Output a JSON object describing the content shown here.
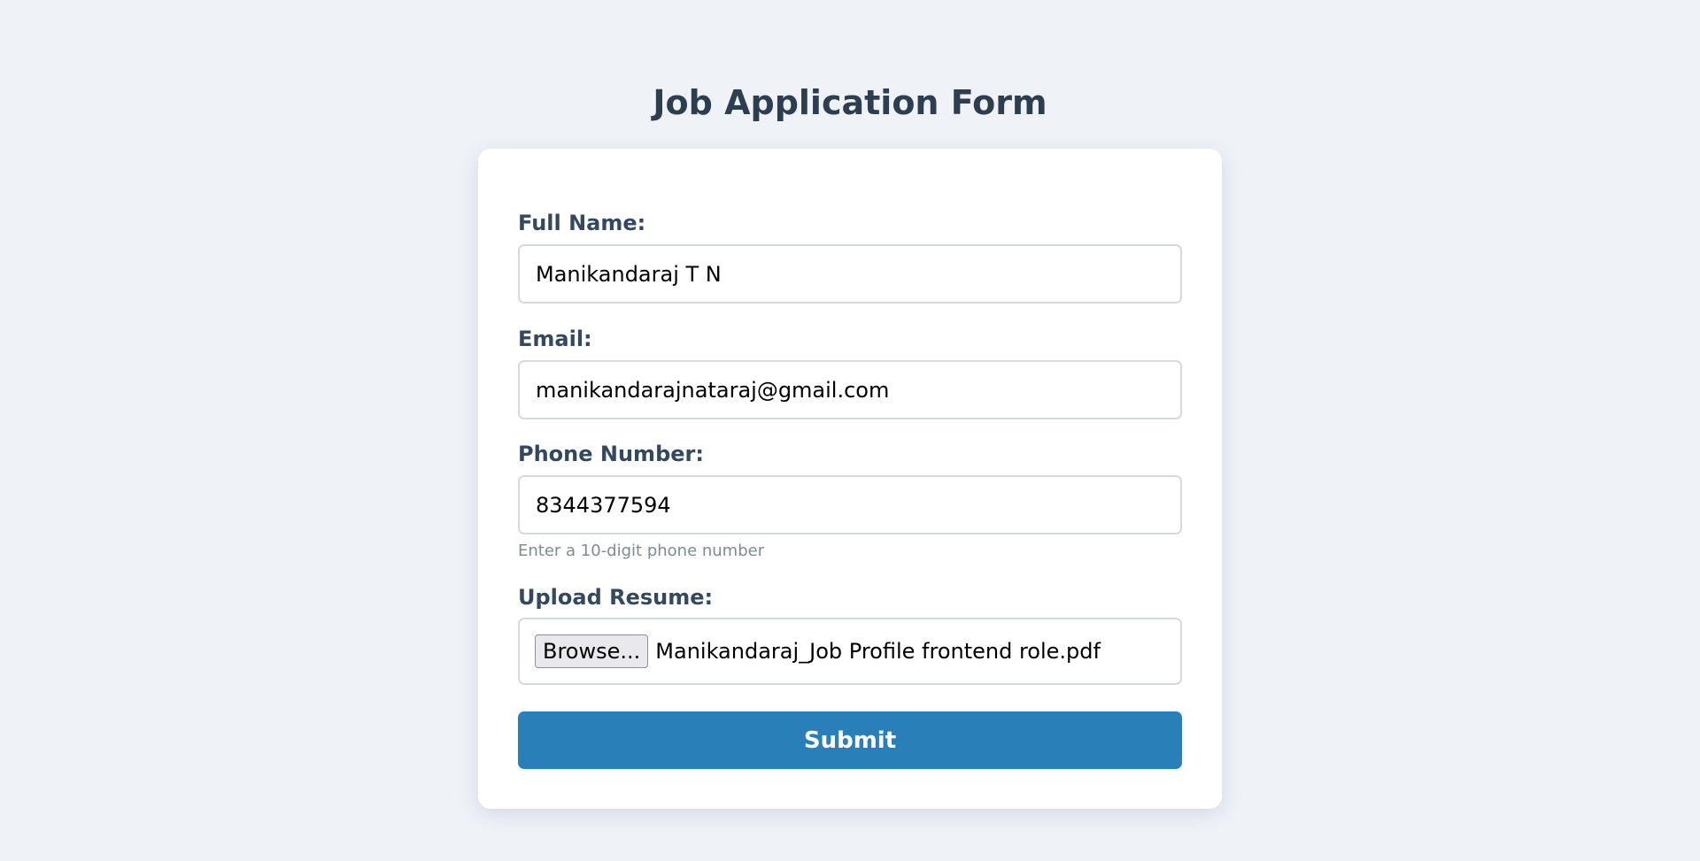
{
  "form": {
    "title": "Job Application Form",
    "full_name": {
      "label": "Full Name:",
      "value": "Manikandaraj T N"
    },
    "email": {
      "label": "Email:",
      "value": "manikandarajnataraj@gmail.com"
    },
    "phone": {
      "label": "Phone Number:",
      "value": "8344377594",
      "hint": "Enter a 10-digit phone number"
    },
    "resume": {
      "label": "Upload Resume:",
      "browse_label": "Browse...",
      "file_name": "Manikandaraj_Job Profile frontend role.pdf"
    },
    "submit_label": "Submit"
  },
  "colors": {
    "background": "#eff3f8",
    "card": "#ffffff",
    "heading_text": "#2c3e50",
    "label_text": "#34495e",
    "hint_text": "#7f8c8d",
    "accent": "#2980b9"
  }
}
